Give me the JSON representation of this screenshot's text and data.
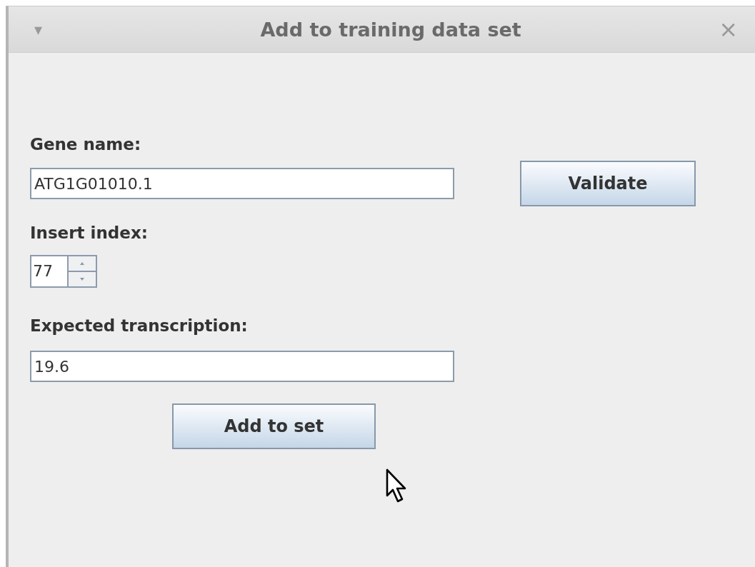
{
  "window": {
    "title": "Add to training data set",
    "menu_glyph": "▾",
    "close_glyph": "×"
  },
  "gene_name": {
    "label": "Gene name:",
    "value": "ATG1G01010.1"
  },
  "validate_button": "Validate",
  "insert_index": {
    "label": "Insert index:",
    "value": "77"
  },
  "expected_transcription": {
    "label": "Expected transcription:",
    "value": "19.6"
  },
  "add_button": "Add to set"
}
